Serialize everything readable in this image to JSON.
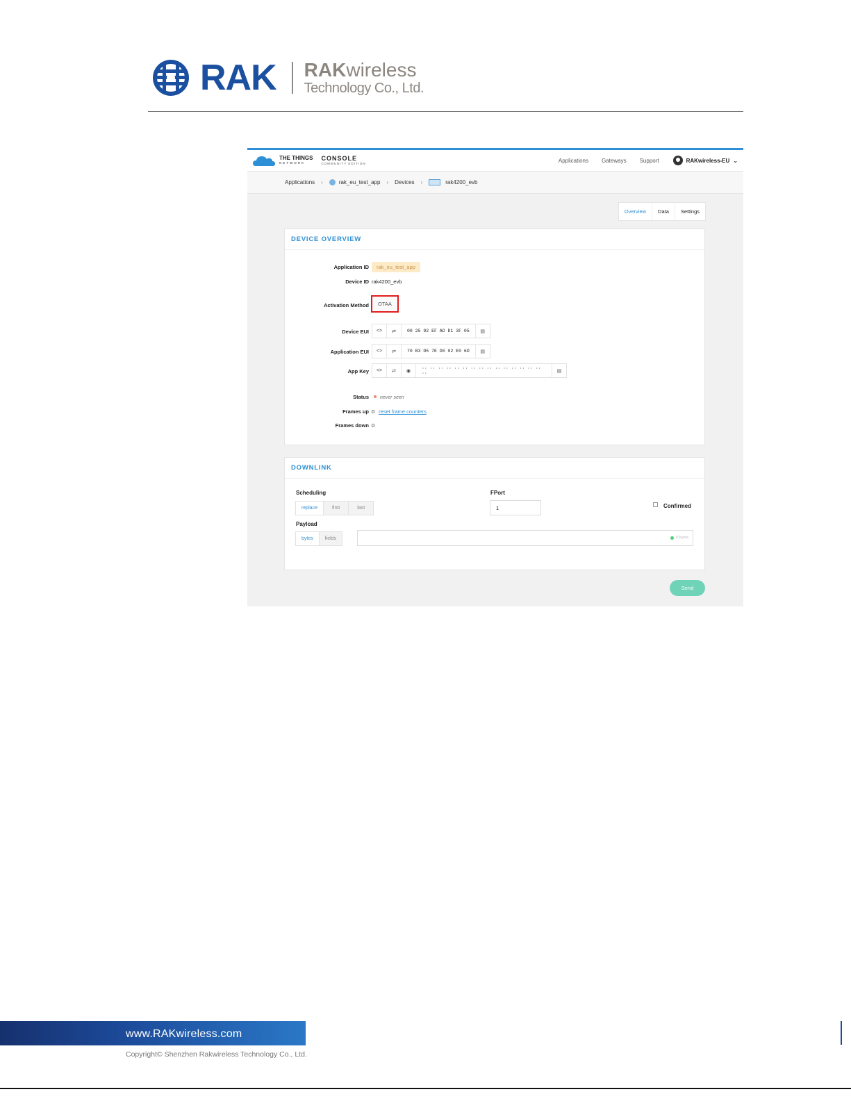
{
  "header": {
    "brand_short": "RAK",
    "brand_name_bold": "RAK",
    "brand_name_rest": "wireless",
    "brand_sub": "Technology Co., Ltd."
  },
  "ttn": {
    "logo_line1": "THE THINGS",
    "logo_line2": "NETWORK",
    "console_line1": "CONSOLE",
    "console_line2": "COMMUNITY EDITION",
    "nav": [
      "Applications",
      "Gateways",
      "Support"
    ],
    "user": "RAKwireless-EU"
  },
  "breadcrumb": {
    "items": [
      "Applications",
      "rak_eu_test_app",
      "Devices",
      "rak4200_evb"
    ],
    "separator": "›"
  },
  "tabs": [
    "Overview",
    "Data",
    "Settings"
  ],
  "overview": {
    "title": "DEVICE OVERVIEW",
    "labels": {
      "app_id": "Application ID",
      "device_id": "Device ID",
      "activation": "Activation Method",
      "device_eui": "Device EUI",
      "app_eui": "Application EUI",
      "app_key": "App Key",
      "status": "Status",
      "frames_up": "Frames up",
      "frames_down": "Frames down"
    },
    "values": {
      "app_id": "rak_eu_test_app",
      "device_id": "rak4200_evb",
      "activation": "OTAA",
      "device_eui": "00 25 92 EF AD D1 3F 05",
      "app_eui": "70 B3 D5 7E D0 02 E0 6D",
      "app_key": "·· ·· ·· ·· ·· ·· ·· ·· ·· ·· ·· ·· ·· ·· ·· ··",
      "status": "never seen",
      "frames_up": "0",
      "frames_down": "0",
      "reset_link": "reset frame counters"
    },
    "icons": {
      "code": "<>",
      "swap": "⇄",
      "eye": "◉",
      "copy": "▤"
    }
  },
  "downlink": {
    "title": "DOWNLINK",
    "scheduling_label": "Scheduling",
    "scheduling_options": [
      "replace",
      "first",
      "last"
    ],
    "fport_label": "FPort",
    "fport_value": "1",
    "confirmed_label": "Confirmed",
    "payload_label": "Payload",
    "payload_modes": [
      "bytes",
      "fields"
    ],
    "bytes_count": "0 bytes",
    "send_label": "Send"
  },
  "footer": {
    "url": "www.RAKwireless.com",
    "copyright": "Copyright© Shenzhen Rakwireless Technology Co., Ltd."
  },
  "colors": {
    "accent_blue": "#2d8fd5",
    "brand_blue": "#1b4fa0",
    "send_green": "#6fd3b8",
    "highlight_red": "#e21c1c"
  }
}
